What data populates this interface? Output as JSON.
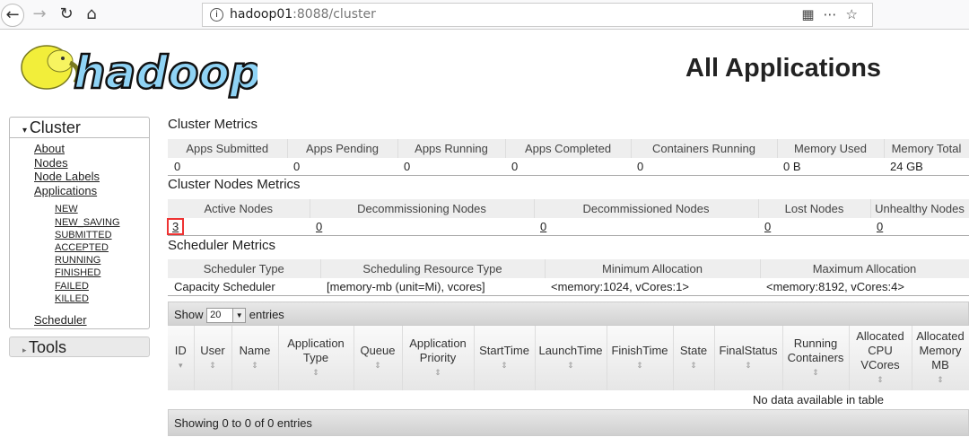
{
  "browser": {
    "url_host": "hadoop01",
    "url_rest": ":8088/cluster"
  },
  "header": {
    "logo_text": "hadoop",
    "title": "All Applications"
  },
  "sidebar": {
    "cluster": "Cluster",
    "links": [
      "About",
      "Nodes",
      "Node Labels",
      "Applications"
    ],
    "states": [
      "NEW",
      "NEW_SAVING",
      "SUBMITTED",
      "ACCEPTED",
      "RUNNING",
      "FINISHED",
      "FAILED",
      "KILLED"
    ],
    "scheduler": "Scheduler",
    "tools": "Tools"
  },
  "cluster_metrics": {
    "title": "Cluster Metrics",
    "headers": [
      "Apps Submitted",
      "Apps Pending",
      "Apps Running",
      "Apps Completed",
      "Containers Running",
      "Memory Used",
      "Memory Total"
    ],
    "values": [
      "0",
      "0",
      "0",
      "0",
      "0",
      "0 B",
      "24 GB"
    ]
  },
  "nodes_metrics": {
    "title": "Cluster Nodes Metrics",
    "headers": [
      "Active Nodes",
      "Decommissioning Nodes",
      "Decommissioned Nodes",
      "Lost Nodes",
      "Unhealthy Nodes"
    ],
    "values": [
      "3",
      "0",
      "0",
      "0",
      "0"
    ]
  },
  "scheduler_metrics": {
    "title": "Scheduler Metrics",
    "headers": [
      "Scheduler Type",
      "Scheduling Resource Type",
      "Minimum Allocation",
      "Maximum Allocation"
    ],
    "values": [
      "Capacity Scheduler",
      "[memory-mb (unit=Mi), vcores]",
      "<memory:1024, vCores:1>",
      "<memory:8192, vCores:4>"
    ]
  },
  "apps": {
    "show": "Show",
    "page_size": "20",
    "entries": "entries",
    "columns": [
      "ID",
      "User",
      "Name",
      "Application Type",
      "Queue",
      "Application Priority",
      "StartTime",
      "LaunchTime",
      "FinishTime",
      "State",
      "FinalStatus",
      "Running Containers",
      "Allocated CPU VCores",
      "Allocated Memory MB"
    ],
    "empty": "No data available in table",
    "footer": "Showing 0 to 0 of 0 entries"
  }
}
